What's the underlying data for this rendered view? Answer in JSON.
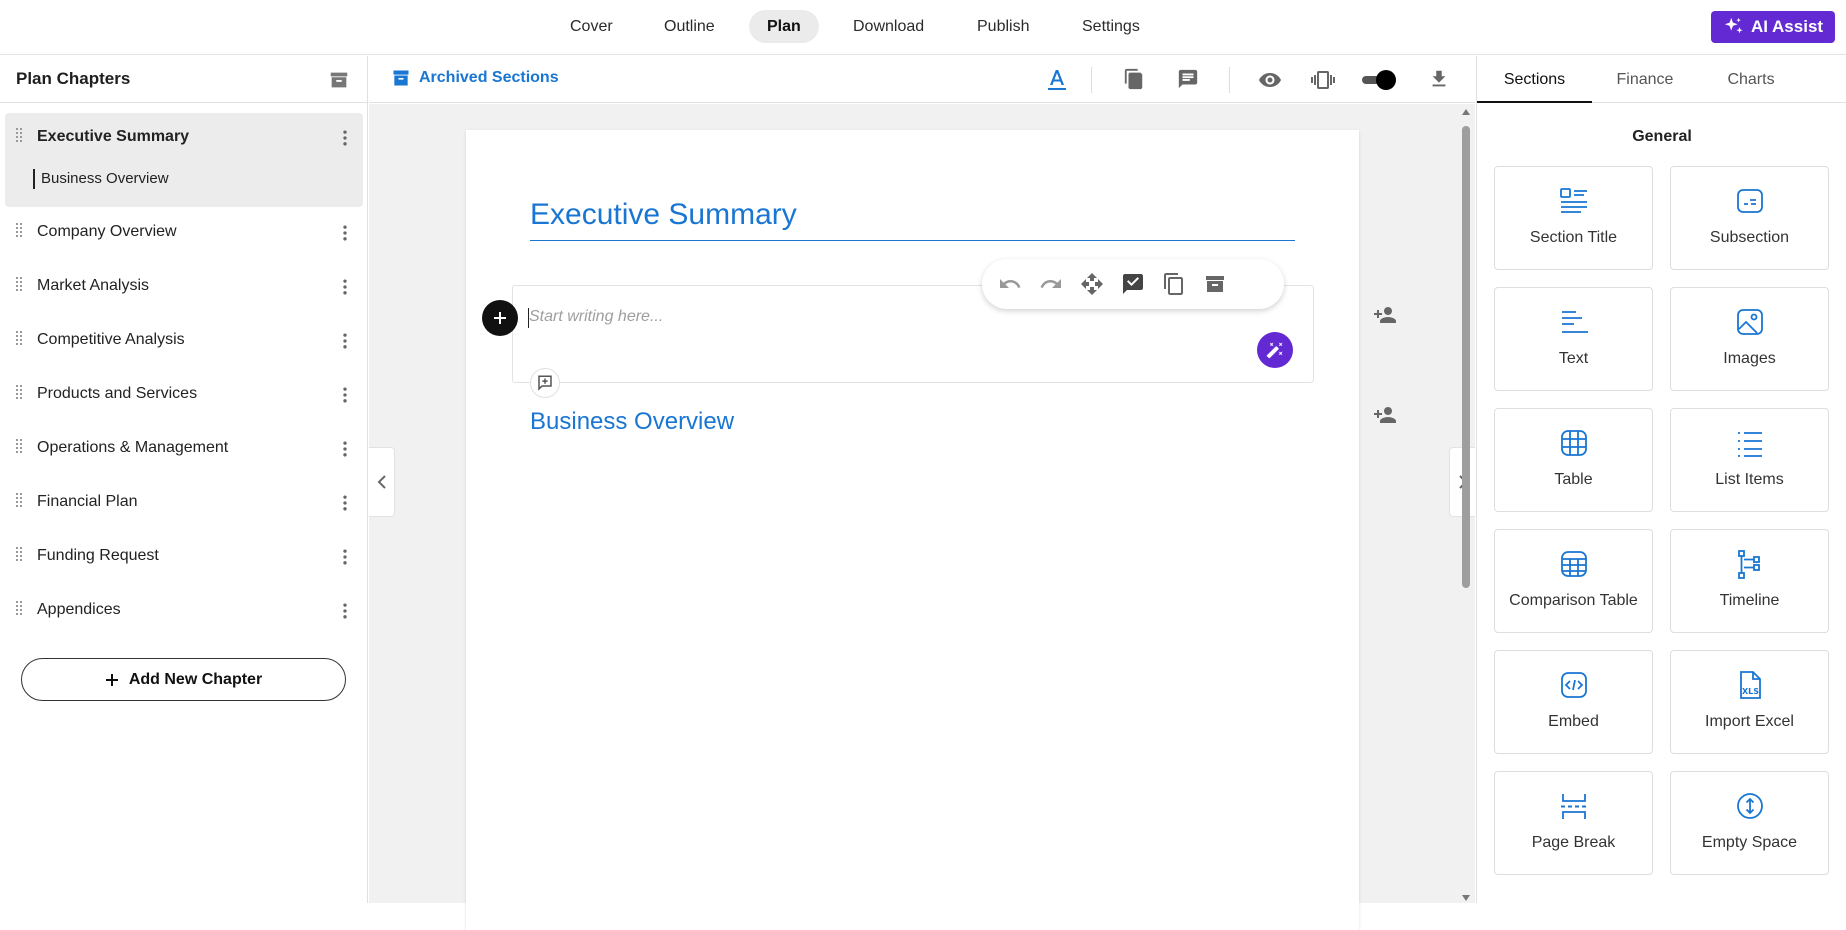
{
  "nav": {
    "tabs": [
      {
        "label": "Cover"
      },
      {
        "label": "Outline"
      },
      {
        "label": "Plan"
      },
      {
        "label": "Download"
      },
      {
        "label": "Publish"
      },
      {
        "label": "Settings"
      }
    ],
    "active": "Plan",
    "ai_assist": "AI Assist"
  },
  "sidebar": {
    "title": "Plan Chapters",
    "chapters": [
      {
        "label": "Executive Summary",
        "sub": "Business Overview"
      },
      {
        "label": "Company Overview"
      },
      {
        "label": "Market Analysis"
      },
      {
        "label": "Competitive Analysis"
      },
      {
        "label": "Products and Services"
      },
      {
        "label": "Operations & Management"
      },
      {
        "label": "Financial Plan"
      },
      {
        "label": "Funding Request"
      },
      {
        "label": "Appendices"
      }
    ],
    "add_chapter": "Add New Chapter"
  },
  "toolbar": {
    "archived_sections": "Archived Sections",
    "toggle_on": true
  },
  "document": {
    "section_title": "Executive Summary",
    "editor_placeholder": "Start writing here...",
    "subsection_title": "Business Overview"
  },
  "right_panel": {
    "tabs": [
      {
        "label": "Sections"
      },
      {
        "label": "Finance"
      },
      {
        "label": "Charts"
      }
    ],
    "active": "Sections",
    "group_title": "General",
    "tiles": [
      {
        "label": "Section Title",
        "icon": "section-title-icon"
      },
      {
        "label": "Subsection",
        "icon": "subsection-icon"
      },
      {
        "label": "Text",
        "icon": "text-icon"
      },
      {
        "label": "Images",
        "icon": "images-icon"
      },
      {
        "label": "Table",
        "icon": "table-icon"
      },
      {
        "label": "List Items",
        "icon": "list-items-icon"
      },
      {
        "label": "Comparison Table",
        "icon": "comparison-table-icon"
      },
      {
        "label": "Timeline",
        "icon": "timeline-icon"
      },
      {
        "label": "Embed",
        "icon": "embed-icon"
      },
      {
        "label": "Import Excel",
        "icon": "import-excel-icon"
      },
      {
        "label": "Page Break",
        "icon": "page-break-icon"
      },
      {
        "label": "Empty Space",
        "icon": "empty-space-icon"
      }
    ]
  },
  "colors": {
    "accent_blue": "#1976d2",
    "brand_purple": "#6329d3",
    "canvas_bg": "#f0f1f0"
  }
}
